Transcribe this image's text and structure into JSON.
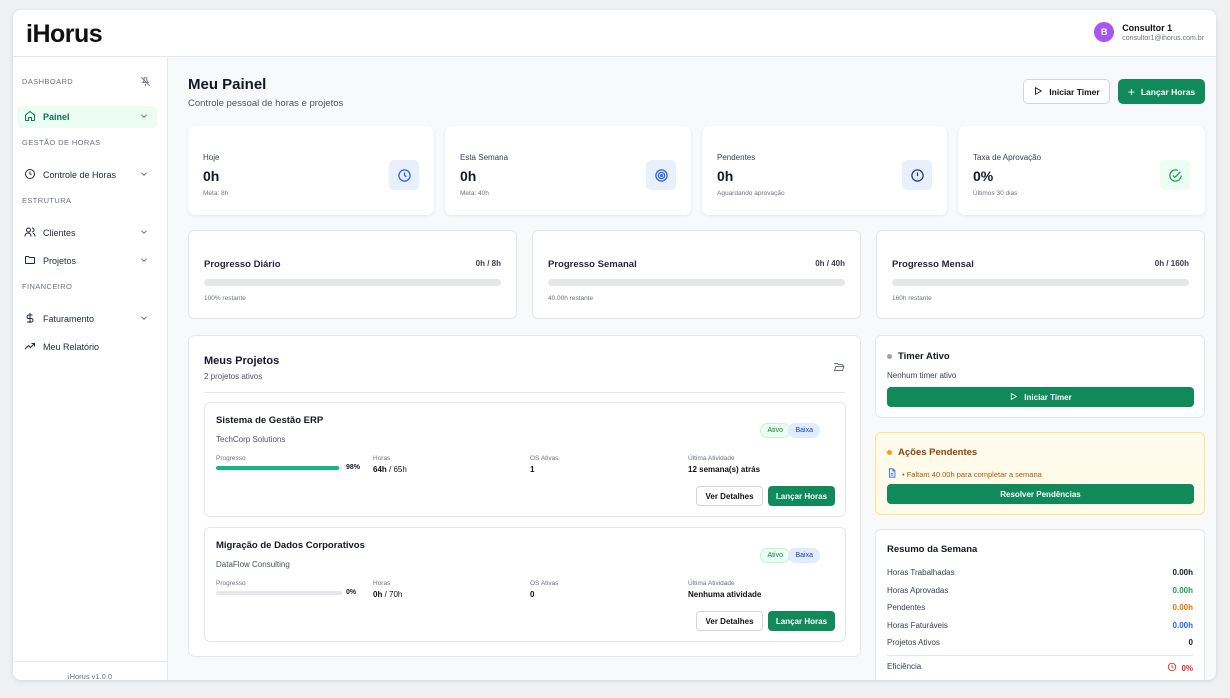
{
  "app": {
    "logo": "iHorus"
  },
  "user": {
    "initial": "B",
    "name": "Consultor 1",
    "email": "consultor1@ihorus.com.br"
  },
  "sidebar": {
    "sections": {
      "dashboard": "DASHBOARD",
      "gestao": "GESTÃO DE HORAS",
      "estrutura": "ESTRUTURA",
      "financeiro": "FINANCEIRO"
    },
    "items": [
      {
        "label": "Painel"
      },
      {
        "label": "Controle de Horas"
      },
      {
        "label": "Clientes"
      },
      {
        "label": "Projetos"
      },
      {
        "label": "Faturamento"
      },
      {
        "label": "Meu Relatório"
      }
    ],
    "version": "iHorus v1.0.0"
  },
  "header": {
    "title": "Meu Painel",
    "subtitle": "Controle pessoal de horas e projetos",
    "start_timer": "Iniciar Timer",
    "log_hours": "Lançar Horas"
  },
  "stats": [
    {
      "label": "Hoje",
      "value": "0h",
      "sub": "Meta: 8h",
      "icon": "clock-icon"
    },
    {
      "label": "Esta Semana",
      "value": "0h",
      "sub": "Meta: 40h",
      "icon": "target-icon"
    },
    {
      "label": "Pendentes",
      "value": "0h",
      "sub": "Aguardando aprovação",
      "icon": "alert-circle-icon"
    },
    {
      "label": "Taxa de Aprovação",
      "value": "0%",
      "sub": "Últimos 30 dias",
      "icon": "check-circle-icon"
    }
  ],
  "progress": [
    {
      "title": "Progresso Diário",
      "value": "0h / 8h",
      "remaining": "100% restante",
      "fraction": 0
    },
    {
      "title": "Progresso Semanal",
      "value": "0h / 40h",
      "remaining": "40.00h restante",
      "fraction": 0
    },
    {
      "title": "Progresso Mensal",
      "value": "0h / 160h",
      "remaining": "160h restante",
      "fraction": 0
    }
  ],
  "projects": {
    "title": "Meus Projetos",
    "subtitle": "2 projetos ativos",
    "labels": {
      "progress": "Progresso",
      "hours": "Horas",
      "os": "OS Ativas",
      "last": "Última Atividade",
      "details": "Ver Detalhes",
      "log": "Lançar Horas"
    },
    "items": [
      {
        "name": "Sistema de Gestão ERP",
        "client": "TechCorp Solutions",
        "status": "Ativo",
        "priority": "Baixa",
        "progress": 0.98,
        "progress_label": "98%",
        "hours_done": "64h",
        "hours_total": " / 65h",
        "os": "1",
        "last": "12 semana(s) atrás"
      },
      {
        "name": "Migração de Dados Corporativos",
        "client": "DataFlow Consulting",
        "status": "Ativo",
        "priority": "Baixa",
        "progress": 0,
        "progress_label": "0%",
        "hours_done": "0h",
        "hours_total": " / 70h",
        "os": "0",
        "last": "Nenhuma atividade"
      }
    ]
  },
  "timer": {
    "title": "Timer Ativo",
    "status": "Nenhum timer ativo",
    "button": "Iniciar Timer"
  },
  "pending": {
    "title": "Ações Pendentes",
    "item": "• Faltam 40.00h para completar a semana",
    "button": "Resolver Pendências"
  },
  "summary": {
    "title": "Resumo da Semana",
    "rows": [
      {
        "label": "Horas Trabalhadas",
        "value": "0.00h",
        "color": "#111827"
      },
      {
        "label": "Horas Aprovadas",
        "value": "0.00h",
        "color": "#16a34a"
      },
      {
        "label": "Pendentes",
        "value": "0.00h",
        "color": "#d97706"
      },
      {
        "label": "Horas Faturáveis",
        "value": "0.00h",
        "color": "#2563eb"
      },
      {
        "label": "Projetos Ativos",
        "value": "0",
        "color": "#111827"
      }
    ],
    "efficiency_label": "Eficiência",
    "efficiency_value": "0%"
  },
  "colors": {
    "primary": "#108a5a",
    "purple": "#a855f7",
    "warning_bg": "#fffbeb",
    "danger": "#dc2626"
  }
}
